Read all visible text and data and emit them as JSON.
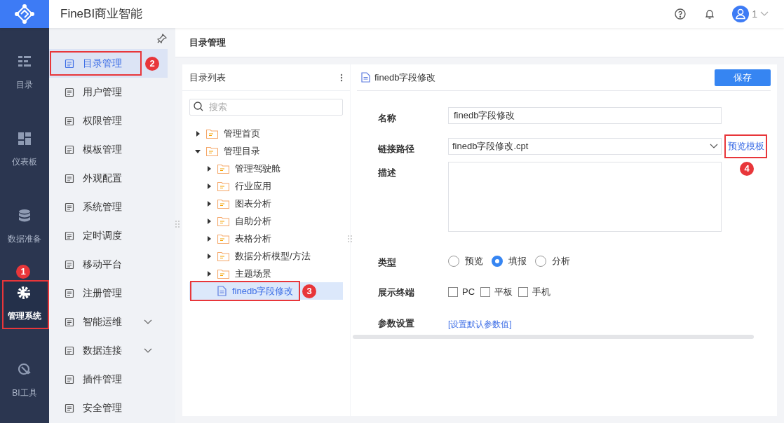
{
  "app": {
    "title": "FineBI商业智能",
    "user": "1"
  },
  "rail": [
    {
      "label": "目录",
      "selected": false
    },
    {
      "label": "仪表板",
      "selected": false
    },
    {
      "label": "数据准备",
      "selected": false
    },
    {
      "label": "管理系统",
      "selected": true,
      "callout": "1"
    },
    {
      "label": "BI工具",
      "selected": false
    }
  ],
  "menu": [
    {
      "label": "目录管理",
      "selected": true,
      "callout": "2"
    },
    {
      "label": "用户管理",
      "selected": false
    },
    {
      "label": "权限管理",
      "selected": false
    },
    {
      "label": "模板管理",
      "selected": false
    },
    {
      "label": "外观配置",
      "selected": false
    },
    {
      "label": "系统管理",
      "selected": false
    },
    {
      "label": "定时调度",
      "selected": false
    },
    {
      "label": "移动平台",
      "selected": false
    },
    {
      "label": "注册管理",
      "selected": false
    },
    {
      "label": "智能运维",
      "selected": false,
      "expandable": true
    },
    {
      "label": "数据连接",
      "selected": false,
      "expandable": true
    },
    {
      "label": "插件管理",
      "selected": false
    },
    {
      "label": "安全管理",
      "selected": false
    }
  ],
  "page_title": "目录管理",
  "catalog": {
    "title": "目录列表",
    "search": {
      "placeholder": "搜索"
    },
    "tree": [
      {
        "label": "管理首页",
        "kind": "folder",
        "expanded": false
      },
      {
        "label": "管理目录",
        "kind": "folder",
        "expanded": true,
        "children": [
          {
            "label": "管理驾驶舱",
            "kind": "folder",
            "expanded": false
          },
          {
            "label": "行业应用",
            "kind": "folder",
            "expanded": false
          },
          {
            "label": "图表分析",
            "kind": "folder",
            "expanded": false
          },
          {
            "label": "自助分析",
            "kind": "folder",
            "expanded": false
          },
          {
            "label": "表格分析",
            "kind": "folder",
            "expanded": false
          },
          {
            "label": "数据分析模型/方法",
            "kind": "folder",
            "expanded": false
          },
          {
            "label": "主题场景",
            "kind": "folder",
            "expanded": false
          },
          {
            "label": "finedb字段修改",
            "kind": "file",
            "selected": true,
            "callout": "3"
          }
        ]
      }
    ]
  },
  "editor": {
    "title": "finedb字段修改",
    "save": "保存",
    "fields": [
      {
        "kind": "text",
        "label": "名称",
        "value": "finedb字段修改"
      },
      {
        "kind": "select",
        "label": "链接路径",
        "value": "finedb字段修改.cpt",
        "link": "预览模板",
        "callout": "4"
      },
      {
        "kind": "textarea",
        "label": "描述"
      },
      {
        "kind": "radio",
        "label": "类型",
        "options": [
          {
            "label": "预览",
            "selected": false
          },
          {
            "label": "填报",
            "selected": true
          },
          {
            "label": "分析",
            "selected": false
          }
        ]
      },
      {
        "kind": "checkbox",
        "label": "展示终端",
        "options": [
          {
            "label": "PC",
            "checked": false
          },
          {
            "label": "平板",
            "checked": false
          },
          {
            "label": "手机",
            "checked": false
          }
        ]
      },
      {
        "kind": "link",
        "label": "参数设置",
        "link": "[设置默认参数值]"
      }
    ]
  }
}
